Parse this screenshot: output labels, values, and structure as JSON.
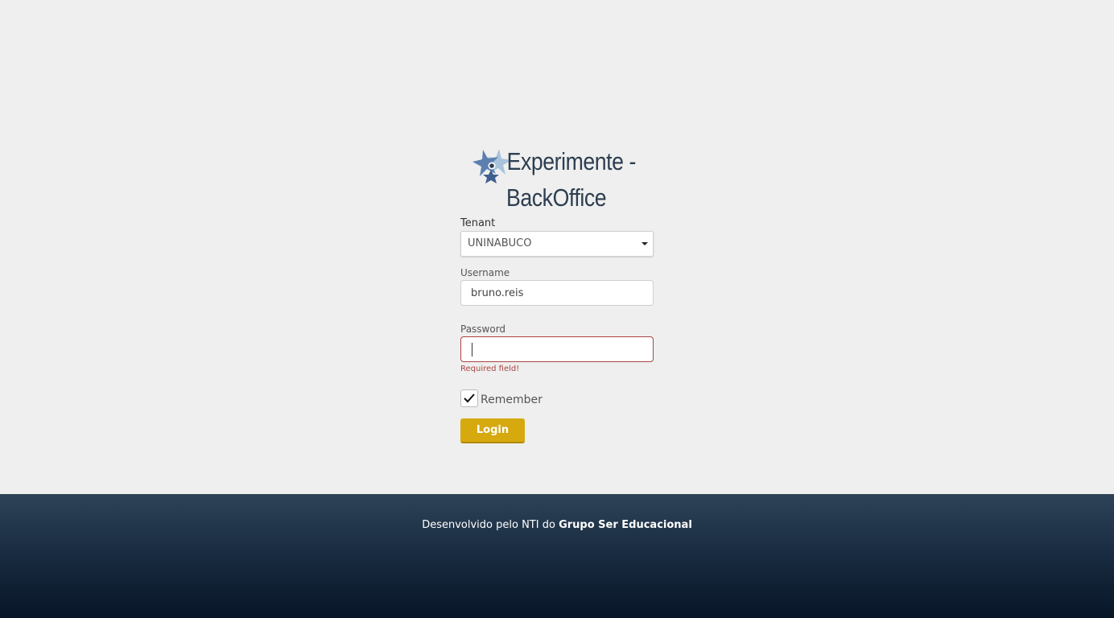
{
  "brand": {
    "title_line1": "Experimente -",
    "title_line2": "BackOffice",
    "logo_icon": "starfish-logo-icon"
  },
  "form": {
    "tenant_label": "Tenant",
    "tenant_value": "UNINABUCO",
    "username_label": "Username",
    "username_value": "bruno.reis",
    "password_label": "Password",
    "password_value": "",
    "password_error": "Required field!",
    "remember_label": "Remember",
    "remember_checked": true,
    "login_label": "Login"
  },
  "footer": {
    "prefix": "Desenvolvido pelo NTI do",
    "company": "Grupo Ser Educacional"
  },
  "colors": {
    "accent_button": "#d6a90e",
    "error": "#a94442",
    "title": "#2c3e50",
    "footer_bg": "#1a2d42"
  }
}
